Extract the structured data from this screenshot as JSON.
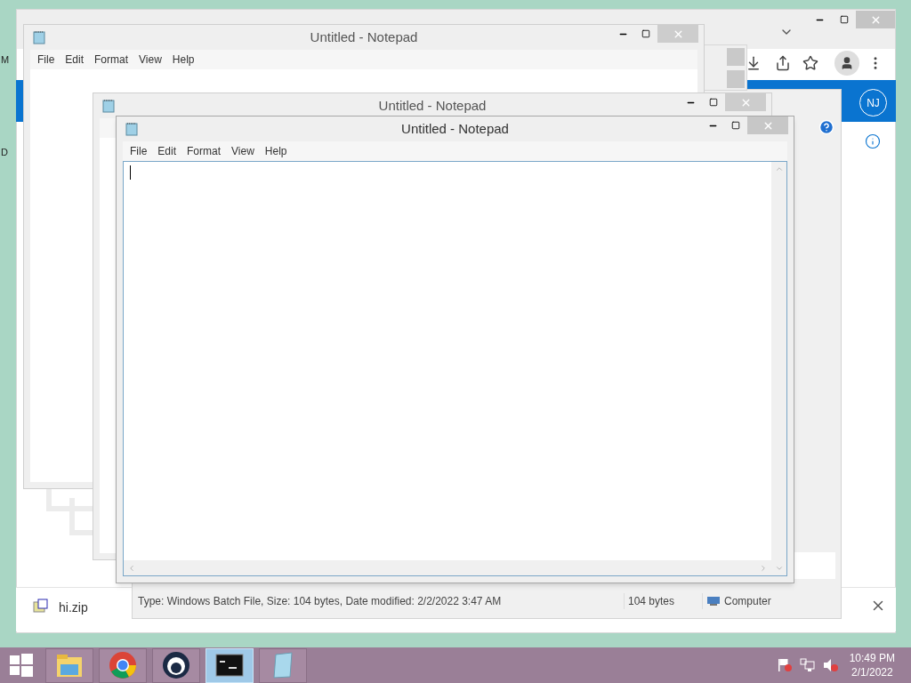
{
  "browser": {
    "avatar": "NJ",
    "edge_letters": [
      "M",
      "D"
    ],
    "download": {
      "filename": "hi.zip"
    }
  },
  "explorer": {
    "status_bar": [
      "Type: Windows Batch File, Size: 104 bytes, Date modified: 2/2/2022 3:47 AM",
      "104 bytes",
      "Computer"
    ]
  },
  "notepads": [
    {
      "title": "Untitled - Notepad",
      "menu": [
        "File",
        "Edit",
        "Format",
        "View",
        "Help"
      ],
      "active": false
    },
    {
      "title": "Untitled - Notepad",
      "active": false
    },
    {
      "title": "Untitled - Notepad",
      "menu": [
        "File",
        "Edit",
        "Format",
        "View",
        "Help"
      ],
      "active": true
    }
  ],
  "taskbar": {
    "items": [
      {
        "kind": "explorer",
        "selected": false
      },
      {
        "kind": "chrome",
        "selected": false
      },
      {
        "kind": "app",
        "selected": false
      },
      {
        "kind": "cmd",
        "selected": true
      },
      {
        "kind": "notepad",
        "selected": false
      }
    ],
    "clock": {
      "time": "10:49 PM",
      "date": "2/1/2022"
    }
  }
}
